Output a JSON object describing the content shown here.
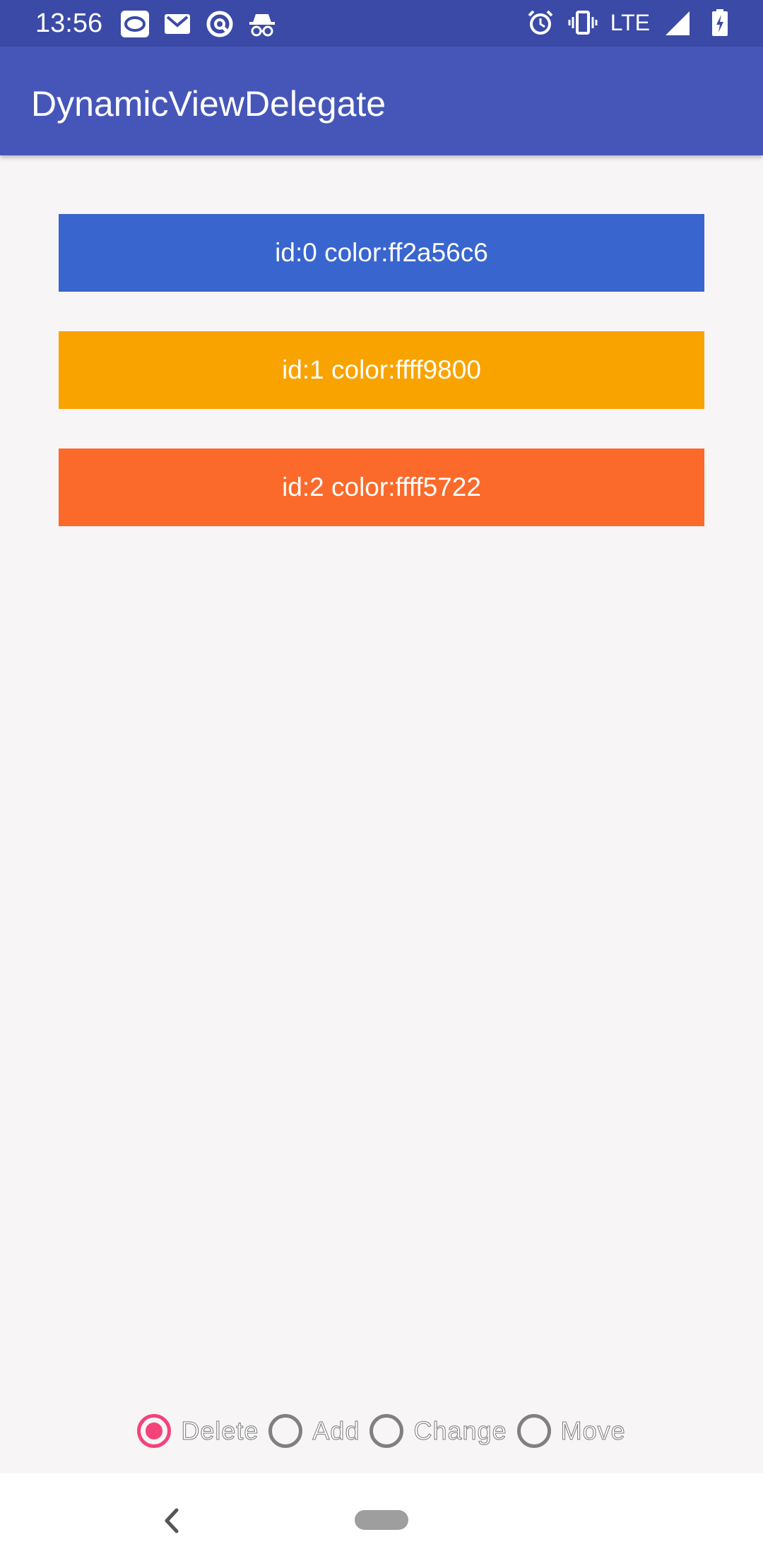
{
  "status_bar": {
    "time": "13:56",
    "network": "LTE",
    "left_icons": [
      "sync-icon",
      "gmail-icon",
      "vpn-icon",
      "incognito-icon"
    ],
    "right_icons": [
      "alarm-icon",
      "vibrate-icon",
      "signal-icon",
      "battery-charging-icon"
    ]
  },
  "app_bar": {
    "title": "DynamicViewDelegate",
    "color": "#4656b8"
  },
  "items": [
    {
      "label": "id:0 color:ff2a56c6",
      "color": "#3965ce"
    },
    {
      "label": "id:1 color:ffff9800",
      "color": "#f9a300"
    },
    {
      "label": "id:2 color:ffff5722",
      "color": "#fb6a2a"
    }
  ],
  "radio_group": {
    "options": [
      {
        "label": "Delete",
        "checked": true
      },
      {
        "label": "Add",
        "checked": false
      },
      {
        "label": "Change",
        "checked": false
      },
      {
        "label": "Move",
        "checked": false
      }
    ],
    "accent": "#f4437a"
  },
  "nav_bar": {
    "icons": [
      "back-icon",
      "home-pill-icon"
    ]
  }
}
